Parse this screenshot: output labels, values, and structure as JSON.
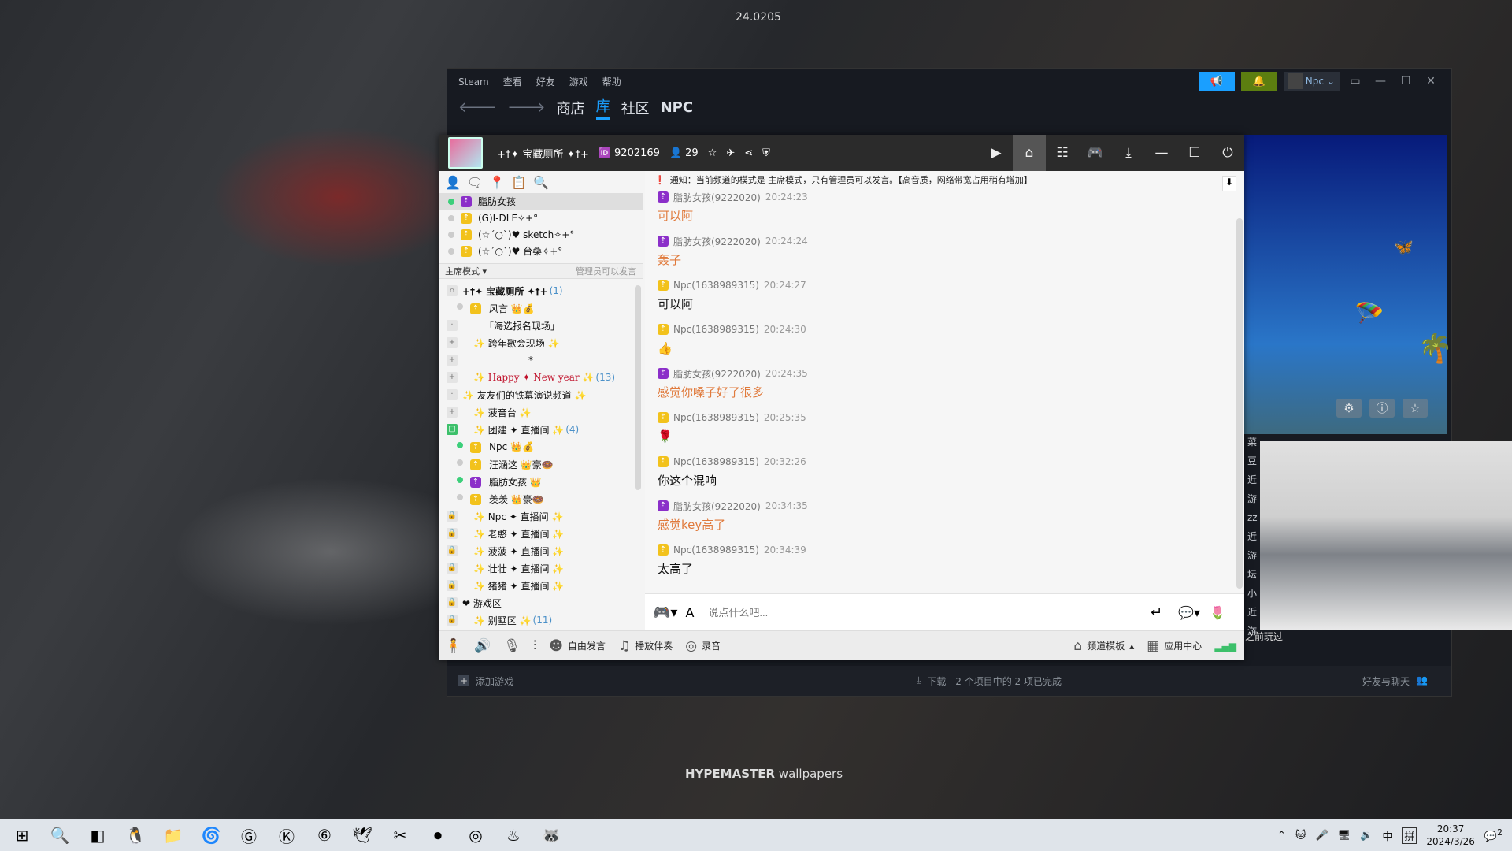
{
  "wallpaper": {
    "top_text": "24.0205",
    "brand_bold": "HYPEMASTER",
    "brand_rest": " wallpapers"
  },
  "steam": {
    "menu": [
      "Steam",
      "查看",
      "好友",
      "游戏",
      "帮助"
    ],
    "nav": [
      "商店",
      "库",
      "社区",
      "NPC"
    ],
    "nav_active": "库",
    "user": "Npc",
    "accent": "#1a9fff",
    "bottom": {
      "add_game": "添加游戏",
      "downloads": "下载 - 2 个项目中的 2 项已完成",
      "friends": "好友与聊天"
    },
    "side_partial": [
      "友",
      "最近",
      "菜豆",
      "近游",
      "zz",
      "近游",
      "坛小",
      "近游"
    ],
    "played_before": "之前玩过"
  },
  "yy": {
    "channel_name": "+†✦ 宝藏厕所 ✦†+",
    "channel_id": "9202169",
    "online_count": "29",
    "members": [
      {
        "name": "脂肪女孩",
        "online": true,
        "role": "purple",
        "selected": true
      },
      {
        "name": "(G)I-DLE✧+°",
        "online": false,
        "role": "gold"
      },
      {
        "name": "(☆´○`)♥ sketch✧+°",
        "online": false,
        "role": "gold"
      },
      {
        "name": "(☆´○`)♥ 台桑✧+°",
        "online": false,
        "role": "gold"
      }
    ],
    "mode": "主席模式 ▾",
    "mode_note": "管理员可以发言",
    "tree": [
      {
        "toggle": "⌂",
        "text": "+†✦ 宝藏厕所 ✦†+",
        "count": "(1)",
        "indent": 0,
        "bold": true
      },
      {
        "toggle": "dot",
        "text": "风言 👑💰",
        "indent": 1,
        "user": true
      },
      {
        "toggle": "·",
        "text": "「海选报名现场」",
        "indent": 2
      },
      {
        "toggle": "+",
        "text": "✨  跨年歌会现场  ✨",
        "indent": 1
      },
      {
        "toggle": "+",
        "text": "*",
        "indent": 6
      },
      {
        "toggle": "+",
        "text": "✨ Happy ✦ New year ✨",
        "count": "(13)",
        "indent": 1,
        "red": true
      },
      {
        "toggle": "·",
        "text": "✨ 友友们的铁幕演说频道 ✨",
        "indent": 0
      },
      {
        "toggle": "+",
        "text": "✨    菠音台    ✨",
        "indent": 1
      },
      {
        "toggle": "lock",
        "text": "✨  团建 ✦ 直播间  ✨",
        "count": "(4)",
        "indent": 1
      },
      {
        "toggle": "on",
        "text": "Npc 👑💰",
        "indent": 1,
        "user": true
      },
      {
        "toggle": "dot",
        "text": "汪涵这 👑豪🍩",
        "indent": 1,
        "user": true
      },
      {
        "toggle": "on",
        "text": "脂肪女孩 👑",
        "indent": 1,
        "user": true
      },
      {
        "toggle": "dot",
        "text": "羡羡 👑豪🍩",
        "indent": 1,
        "user": true
      },
      {
        "toggle": "🔒",
        "text": "✨  Npc ✦ 直播间  ✨",
        "indent": 1
      },
      {
        "toggle": "🔒",
        "text": "✨  老憨 ✦ 直播间  ✨",
        "indent": 1
      },
      {
        "toggle": "🔒",
        "text": "✨  菠菠 ✦ 直播间  ✨",
        "indent": 1
      },
      {
        "toggle": "🔒",
        "text": "✨  壮壮 ✦ 直播间  ✨",
        "indent": 1
      },
      {
        "toggle": "🔒",
        "text": "✨  猪猪 ✦ 直播间  ✨",
        "indent": 1
      },
      {
        "toggle": "🔒",
        "text": "❤    游戏区",
        "indent": 0
      },
      {
        "toggle": "🔒",
        "text": "✨    别墅区    ✨",
        "count": "(11)",
        "indent": 1
      }
    ],
    "notice": "通知：当前频道的模式是 主席模式，只有管理员可以发言。【高音质，网络带宽占用稍有增加】",
    "messages": [
      {
        "name": "脂肪女孩(9222020)",
        "time": "20:24:23",
        "text": "可以阿",
        "role": "purple",
        "color": "#e07a3c"
      },
      {
        "name": "脂肪女孩(9222020)",
        "time": "20:24:24",
        "text": "轰子",
        "role": "purple",
        "color": "#e07a3c"
      },
      {
        "name": "Npc(1638989315)",
        "time": "20:24:27",
        "text": "可以阿",
        "role": "gold",
        "color": "#111111"
      },
      {
        "name": "Npc(1638989315)",
        "time": "20:24:30",
        "text": "👍",
        "role": "gold",
        "color": "#111111"
      },
      {
        "name": "脂肪女孩(9222020)",
        "time": "20:24:35",
        "text": "感觉你嗓子好了很多",
        "role": "purple",
        "color": "#e07a3c"
      },
      {
        "name": "Npc(1638989315)",
        "time": "20:25:35",
        "text": "🌹",
        "role": "gold",
        "color": "#111111"
      },
      {
        "name": "Npc(1638989315)",
        "time": "20:32:26",
        "text": "你这个混响",
        "role": "gold",
        "color": "#111111"
      },
      {
        "name": "脂肪女孩(9222020)",
        "time": "20:34:35",
        "text": "感觉key高了",
        "role": "purple",
        "color": "#e07a3c"
      },
      {
        "name": "Npc(1638989315)",
        "time": "20:34:39",
        "text": "太高了",
        "role": "gold",
        "color": "#111111"
      }
    ],
    "input_placeholder": "说点什么吧...",
    "bottom": {
      "free_speech": "自由发言",
      "accompaniment": "播放伴奏",
      "record": "录音",
      "template": "频道模板",
      "app_center": "应用中心"
    }
  },
  "taskbar": {
    "time": "20:37",
    "date": "2024/3/26",
    "ime_lang": "中",
    "ime_mode": "拼",
    "notifications": "2",
    "apps": [
      "start-icon",
      "search-icon",
      "task-view-icon",
      "qq-icon",
      "file-explorer-icon",
      "edge-icon",
      "app-g-icon",
      "kugou-icon",
      "netease-music-icon",
      "feishu-icon",
      "capcut-icon",
      "obs-icon",
      "app-ring-icon",
      "steam-icon",
      "yy-icon"
    ]
  }
}
